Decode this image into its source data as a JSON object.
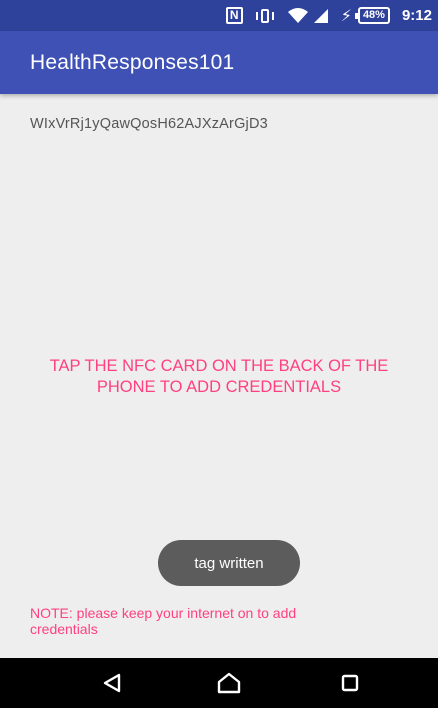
{
  "status_bar": {
    "time": "9:12",
    "battery_percent": "48%",
    "nfc_glyph": "N",
    "icons": [
      "nfc-icon",
      "vibrate-icon",
      "wifi-icon",
      "cell-signal-icon",
      "charging-icon",
      "battery-icon"
    ]
  },
  "app_bar": {
    "title": "HealthResponses101"
  },
  "content": {
    "token": "WIxVrRj1yQawQosH62AJXzArGjD3",
    "instruction_line1": "TAP THE NFC CARD ON THE BACK OF THE",
    "instruction_line2": "PHONE TO ADD CREDENTIALS",
    "note_line1": "NOTE: please keep your internet on to add",
    "note_line2": "credentials"
  },
  "toast": {
    "message": "tag written"
  },
  "nav_bar": {
    "icons": [
      "back-icon",
      "home-icon",
      "recents-icon"
    ]
  },
  "colors": {
    "status_bar": "#2f429b",
    "app_bar": "#3f51b5",
    "accent": "#ff4081",
    "background": "#eeeeee",
    "toast": "#5c5c5c",
    "nav_bar": "#000000"
  }
}
